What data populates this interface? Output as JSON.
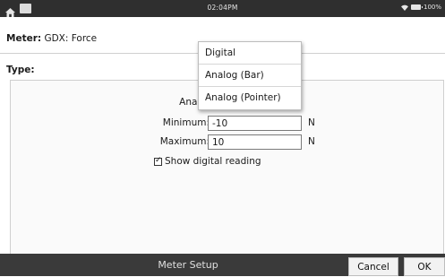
{
  "status_bar": {
    "time": "02:04PM",
    "battery": "100%",
    "icons": [
      "home-icon",
      "calculator-icon",
      "wifi-icon",
      "battery-icon"
    ]
  },
  "meter": {
    "label": "Meter:",
    "value": "GDX: Force"
  },
  "type": {
    "label": "Type:"
  },
  "dropdown": {
    "options": [
      "Digital",
      "Analog (Bar)",
      "Analog (Pointer)"
    ]
  },
  "range": {
    "title": "Analog Meter Range",
    "minimum_label": "Minimum:",
    "minimum_value": "-10",
    "maximum_label": "Maximum:",
    "maximum_value": "10",
    "unit": "N",
    "show_digital_label": "Show digital reading",
    "show_digital_checked": true
  },
  "bottom_bar": {
    "title": "Meter Setup",
    "cancel_label": "Cancel",
    "ok_label": "OK"
  }
}
